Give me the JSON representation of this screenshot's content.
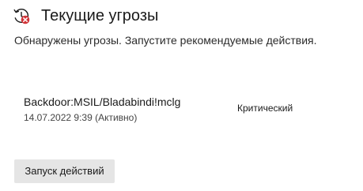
{
  "header": {
    "icon": "threat-history-icon",
    "title": "Текущие угрозы"
  },
  "subtitle": "Обнаружены угрозы. Запустите рекомендуемые действия.",
  "threats": [
    {
      "name": "Backdoor:MSIL/Bladabindi!mclg",
      "detected": "14.07.2022 9:39 (Активно)",
      "severity": "Критический"
    }
  ],
  "actions": {
    "start_label": "Запуск действий"
  },
  "colors": {
    "alert_red": "#d13438",
    "button_bg": "#e5e5e5"
  }
}
